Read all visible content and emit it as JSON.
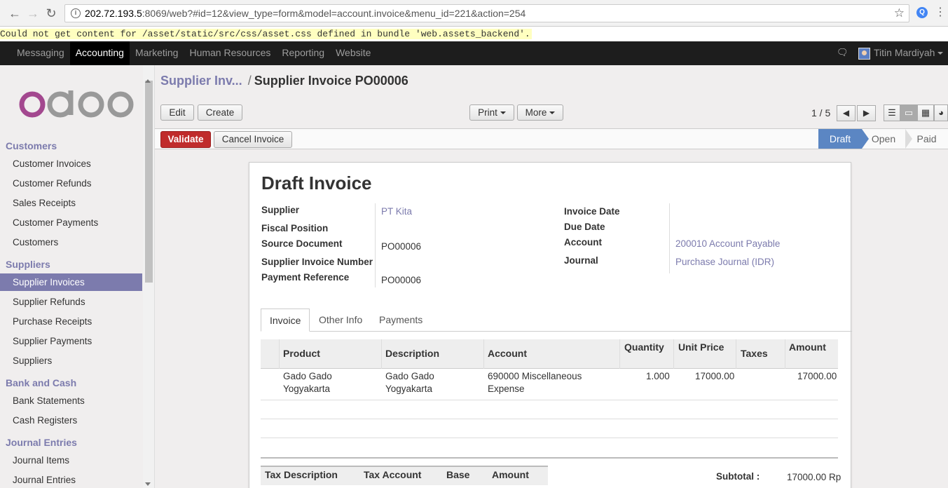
{
  "browser": {
    "url_host": "202.72.193.5",
    "url_rest": ":8069/web?#id=12&view_type=form&model=account.invoice&menu_id=221&action=254",
    "error_text": "Could not get content for /asset/static/src/css/asset.css defined in bundle 'web.assets_backend'."
  },
  "topbar": {
    "menus": [
      "Messaging",
      "Accounting",
      "Marketing",
      "Human Resources",
      "Reporting",
      "Website"
    ],
    "active_menu": "Accounting",
    "user_name": "Titin Mardiyah"
  },
  "sidebar": {
    "sections": [
      {
        "title": "Customers",
        "items": [
          "Customer Invoices",
          "Customer Refunds",
          "Sales Receipts",
          "Customer Payments",
          "Customers"
        ]
      },
      {
        "title": "Suppliers",
        "items": [
          "Supplier Invoices",
          "Supplier Refunds",
          "Purchase Receipts",
          "Supplier Payments",
          "Suppliers"
        ]
      },
      {
        "title": "Bank and Cash",
        "items": [
          "Bank Statements",
          "Cash Registers"
        ]
      },
      {
        "title": "Journal Entries",
        "items": [
          "Journal Items",
          "Journal Entries"
        ]
      }
    ],
    "active_item": "Supplier Invoices"
  },
  "breadcrumb": {
    "parent": "Supplier Inv...",
    "separator": "/",
    "current": "Supplier Invoice PO00006"
  },
  "toolbar": {
    "edit_label": "Edit",
    "create_label": "Create",
    "print_label": "Print",
    "more_label": "More",
    "pager_text": "1 / 5"
  },
  "statusbar": {
    "validate_label": "Validate",
    "cancel_label": "Cancel Invoice",
    "stages": [
      "Draft",
      "Open",
      "Paid"
    ],
    "active_stage": "Draft"
  },
  "form": {
    "title": "Draft Invoice",
    "left_fields": [
      {
        "label": "Supplier",
        "value": "PT Kita"
      },
      {
        "label": "Fiscal Position",
        "value": ""
      },
      {
        "label": "Source Document",
        "value": "PO00006"
      },
      {
        "label": "Supplier Invoice Number",
        "value": ""
      },
      {
        "label": "Payment Reference",
        "value": "PO00006"
      }
    ],
    "right_fields": [
      {
        "label": "Invoice Date",
        "value": ""
      },
      {
        "label": "Due Date",
        "value": ""
      },
      {
        "label": "Account",
        "value": "200010 Account Payable"
      },
      {
        "label": "Journal",
        "value": "Purchase Journal (IDR)"
      }
    ]
  },
  "tabs": [
    "Invoice",
    "Other Info",
    "Payments"
  ],
  "active_tab": "Invoice",
  "lines": {
    "headers": [
      "Product",
      "Description",
      "Account",
      "Quantity",
      "Unit Price",
      "Taxes",
      "Amount"
    ],
    "rows": [
      {
        "product_l1": "Gado Gado",
        "product_l2": "Yogyakarta",
        "desc_l1": "Gado Gado",
        "desc_l2": "Yogyakarta",
        "account_l1": "690000 Miscellaneous",
        "account_l2": "Expense",
        "quantity": "1.000",
        "unit_price": "17000.00",
        "taxes": "",
        "amount": "17000.00"
      }
    ]
  },
  "tax_table": {
    "headers": [
      "Tax Description",
      "Tax Account",
      "Base",
      "Amount"
    ]
  },
  "totals": {
    "subtotal_label": "Subtotal :",
    "subtotal_value": "17000.00 Rp"
  }
}
